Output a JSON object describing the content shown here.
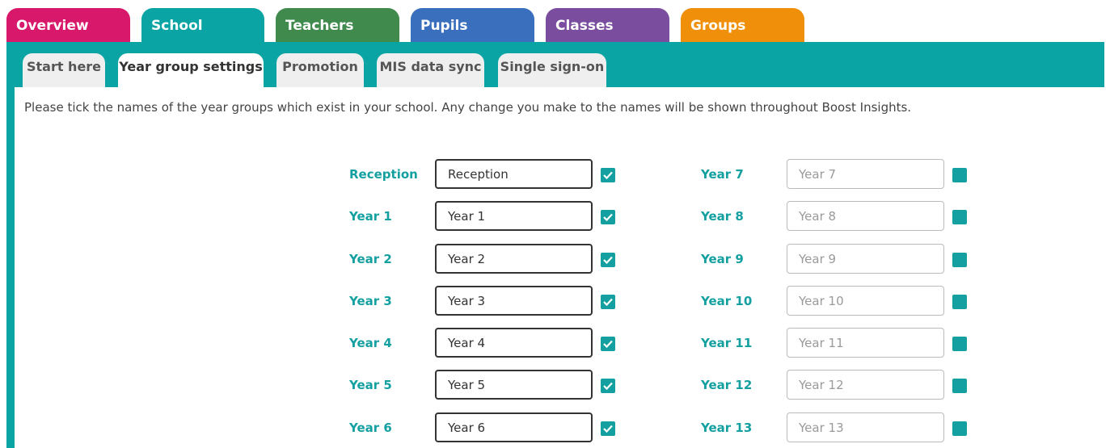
{
  "top_tabs": [
    {
      "label": "Overview",
      "color": "#d8186a"
    },
    {
      "label": "School",
      "color": "#0aa4a4"
    },
    {
      "label": "Teachers",
      "color": "#3f8a4c"
    },
    {
      "label": "Pupils",
      "color": "#3a6fbe"
    },
    {
      "label": "Classes",
      "color": "#7b4d9e"
    },
    {
      "label": "Groups",
      "color": "#f0900a"
    }
  ],
  "active_top_tab": "School",
  "sub_tabs": [
    "Start here",
    "Year group settings",
    "Promotion",
    "MIS data sync",
    "Single sign-on"
  ],
  "active_sub_tab": "Year group settings",
  "intro_text": "Please tick the names of the year groups which exist in your school. Any change you make to the names will be shown throughout Boost Insights.",
  "year_groups_left": [
    {
      "label": "Reception",
      "value": "Reception",
      "checked": true
    },
    {
      "label": "Year 1",
      "value": "Year 1",
      "checked": true
    },
    {
      "label": "Year 2",
      "value": "Year 2",
      "checked": true
    },
    {
      "label": "Year 3",
      "value": "Year 3",
      "checked": true
    },
    {
      "label": "Year 4",
      "value": "Year 4",
      "checked": true
    },
    {
      "label": "Year 5",
      "value": "Year 5",
      "checked": true
    },
    {
      "label": "Year 6",
      "value": "Year 6",
      "checked": true
    }
  ],
  "year_groups_right": [
    {
      "label": "Year 7",
      "value": "Year 7",
      "checked": false
    },
    {
      "label": "Year 8",
      "value": "Year 8",
      "checked": false
    },
    {
      "label": "Year 9",
      "value": "Year 9",
      "checked": false
    },
    {
      "label": "Year 10",
      "value": "Year 10",
      "checked": false
    },
    {
      "label": "Year 11",
      "value": "Year 11",
      "checked": false
    },
    {
      "label": "Year 12",
      "value": "Year 12",
      "checked": false
    },
    {
      "label": "Year 13",
      "value": "Year 13",
      "checked": false
    }
  ],
  "accent_color": "#0aa4a4"
}
